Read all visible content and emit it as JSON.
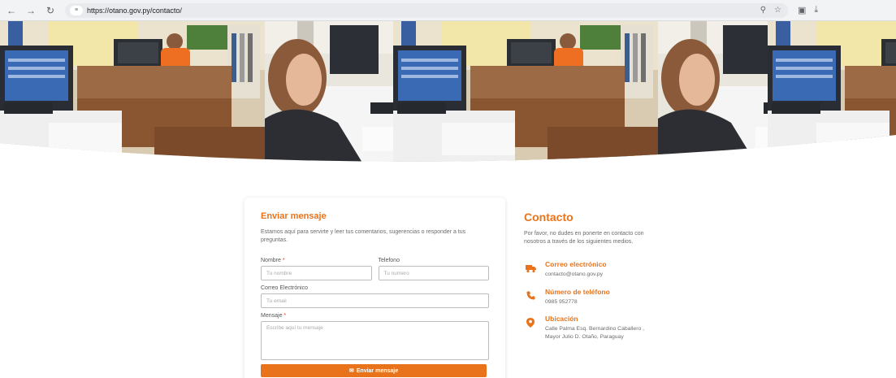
{
  "browser": {
    "url": "https://otano.gov.py/contacto/"
  },
  "form": {
    "title": "Enviar mensaje",
    "description": "Estamos aquí para servirte y leer tus comentarios, sugerencias o responder a tus preguntas.",
    "name_label": "Nombre",
    "name_placeholder": "Tu nombre",
    "phone_label": "Telefono",
    "phone_placeholder": "Tu numero",
    "email_label": "Correo Electrónico",
    "email_placeholder": "Tu email",
    "message_label": "Mensaje",
    "message_placeholder": "Escribe aquí tu mensaje",
    "required_mark": "*",
    "submit_label": "Enviar mensaje"
  },
  "contact": {
    "title": "Contacto",
    "description": "Por favor, no dudes en ponerte en contacto con nosotros a través de los siguientes medios.",
    "items": [
      {
        "heading": "Correo electrónico",
        "text": "contacto@otano.gov.py",
        "icon": "truck-icon"
      },
      {
        "heading": "Número de teléfono",
        "text": "0985 952778",
        "icon": "phone-icon"
      },
      {
        "heading": "Ubicación",
        "text": "Calle Palma Esq. Bernardino Caballero , Mayor Julio D. Otaño, Paraguay",
        "icon": "location-pin-icon"
      }
    ]
  },
  "colors": {
    "accent": "#e8731b",
    "required": "#e03b24"
  }
}
